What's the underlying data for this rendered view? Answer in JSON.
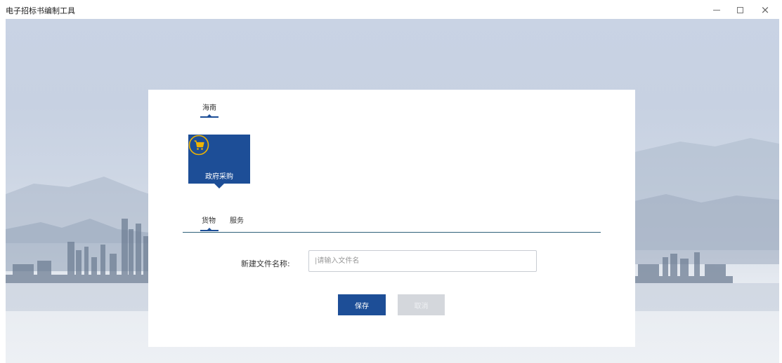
{
  "window": {
    "title": "电子招标书编制工具",
    "controls": [
      "minimize-icon",
      "maximize-icon",
      "close-icon"
    ],
    "close_glyph": "×"
  },
  "form": {
    "region_tab": "海南",
    "category": {
      "label": "政府采购",
      "icon": "shopping-cart-icon"
    },
    "subtabs": [
      "货物",
      "服务"
    ],
    "field_label": "新建文件名称:",
    "field_placeholder": "|请输入文件名",
    "field_value": "",
    "save_label": "保存",
    "cancel_label": "取消"
  },
  "colors": {
    "accent": "#1d4e97",
    "icon_gold": "#f0b400",
    "disabled": "#d4d7dc",
    "divider": "#2e6079"
  }
}
